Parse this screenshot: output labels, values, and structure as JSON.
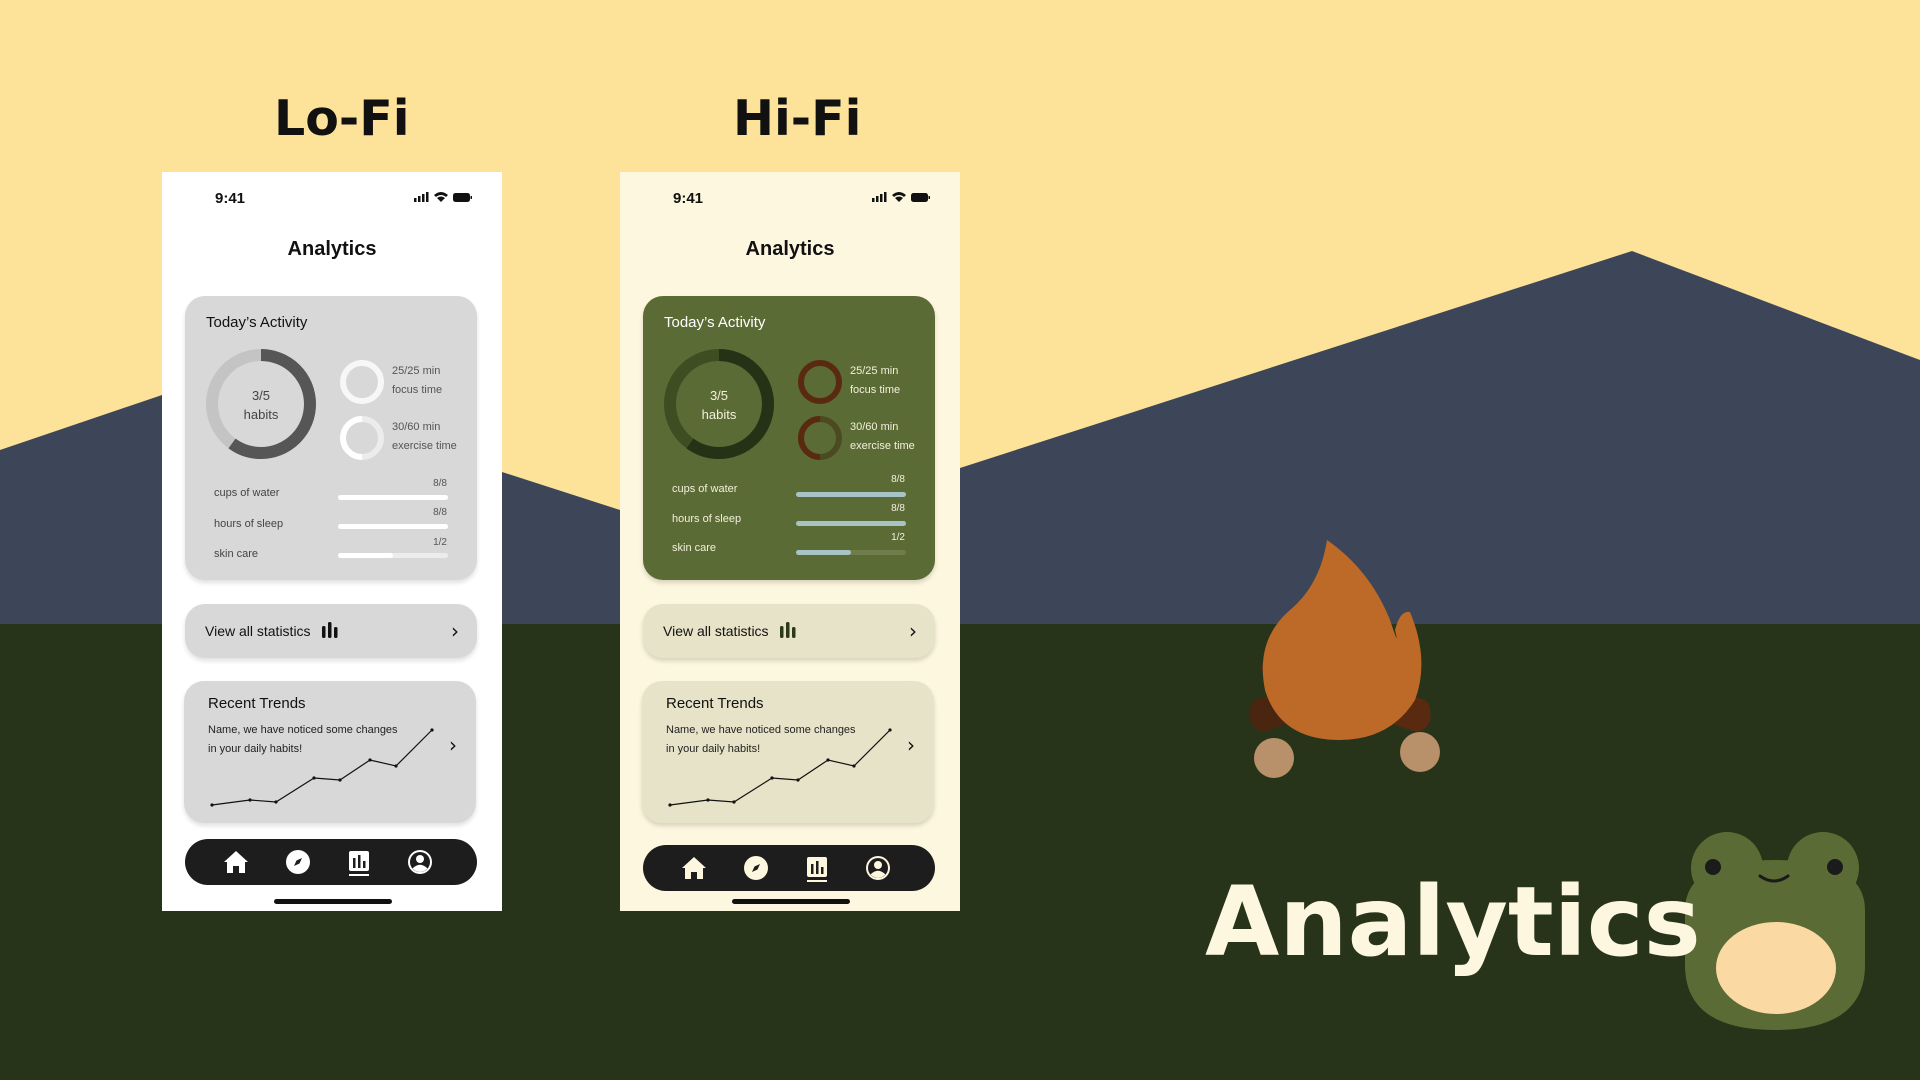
{
  "colors": {
    "sky": "#fde39a",
    "mountain": "#3d4659",
    "ground": "#28341a",
    "hifi_accent": "#5b6b35",
    "hifi_bg": "#fdf7df",
    "bar_fill_hifi": "#a8c3c5",
    "ring_hifi": "#5a2a10"
  },
  "labels": {
    "lofi": "Lo-Fi",
    "hifi": "Hi-Fi",
    "showcase_title": "Analytics"
  },
  "lofi": {
    "status_time": "9:41",
    "title": "Analytics",
    "activity": {
      "title": "Today’s Activity",
      "habits_value": "3/5",
      "habits_label": "habits",
      "habits_progress": 0.6,
      "focus_value": "25/25 min",
      "focus_label": "focus time",
      "exercise_value": "30/60 min",
      "exercise_label": "exercise time",
      "rows": [
        {
          "label": "cups of water",
          "value": "8/8",
          "progress": 1.0
        },
        {
          "label": "hours of sleep",
          "value": "8/8",
          "progress": 1.0
        },
        {
          "label": "skin care",
          "value": "1/2",
          "progress": 0.5
        }
      ]
    },
    "view_all": "View all statistics",
    "trends": {
      "title": "Recent Trends",
      "body": "Name, we have noticed some changes in your daily habits!"
    },
    "nav": [
      "home-icon",
      "compass-icon",
      "chart-icon",
      "profile-icon"
    ]
  },
  "hifi": {
    "status_time": "9:41",
    "title": "Analytics",
    "activity": {
      "title": "Today’s Activity",
      "habits_value": "3/5",
      "habits_label": "habits",
      "habits_progress": 0.6,
      "focus_value": "25/25 min",
      "focus_label": "focus time",
      "exercise_value": "30/60 min",
      "exercise_label": "exercise time",
      "rows": [
        {
          "label": "cups of water",
          "value": "8/8",
          "progress": 1.0
        },
        {
          "label": "hours of sleep",
          "value": "8/8",
          "progress": 1.0
        },
        {
          "label": "skin care",
          "value": "1/2",
          "progress": 0.5
        }
      ]
    },
    "view_all": "View all statistics",
    "trends": {
      "title": "Recent Trends",
      "body": "Name, we have noticed some changes in your daily habits!"
    },
    "nav": [
      "home-icon",
      "compass-icon",
      "chart-icon",
      "profile-icon"
    ]
  }
}
